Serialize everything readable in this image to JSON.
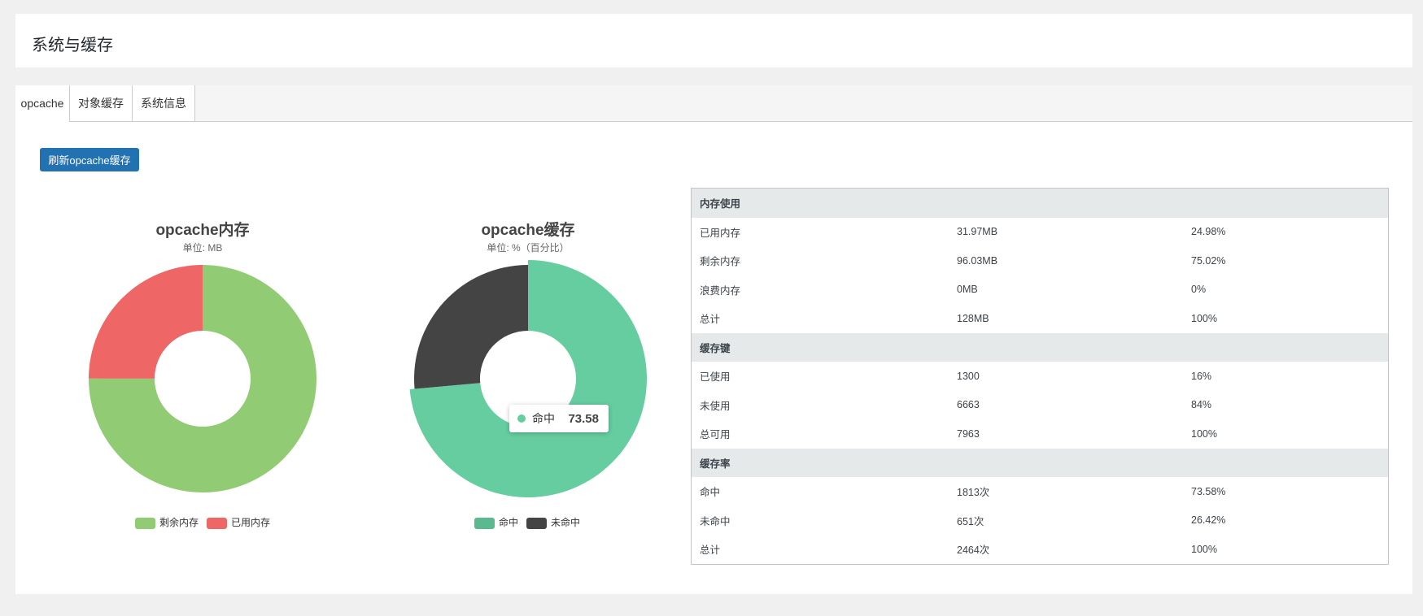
{
  "page_title": "系统与缓存",
  "tabs": [
    {
      "label": "opcache"
    },
    {
      "label": "对象缓存"
    },
    {
      "label": "系统信息"
    }
  ],
  "refresh_button": "刷新opcache缓存",
  "chart_data": [
    {
      "type": "pie",
      "title": "opcache内存",
      "subtitle": "单位: MB",
      "legend_position": "bottom",
      "slices": [
        {
          "name": "剩余内存",
          "value": 96.03,
          "color": "#91cc75"
        },
        {
          "name": "已用内存",
          "value": 31.97,
          "color": "#ee6666"
        }
      ]
    },
    {
      "type": "pie",
      "title": "opcache缓存",
      "subtitle": "单位: %（百分比）",
      "legend_position": "bottom",
      "slices": [
        {
          "name": "命中",
          "value": 73.58,
          "color": "#66cda1",
          "legend_color": "#5bb990"
        },
        {
          "name": "未命中",
          "value": 26.42,
          "color": "#444444"
        }
      ],
      "tooltip": {
        "name": "命中",
        "value": "73.58"
      }
    }
  ],
  "table": [
    {
      "section": "内存使用",
      "rows": [
        [
          "已用内存",
          "31.97MB",
          "24.98%"
        ],
        [
          "剩余内存",
          "96.03MB",
          "75.02%"
        ],
        [
          "浪费内存",
          "0MB",
          "0%"
        ],
        [
          "总计",
          "128MB",
          "100%"
        ]
      ]
    },
    {
      "section": "缓存键",
      "rows": [
        [
          "已使用",
          "1300",
          "16%"
        ],
        [
          "未使用",
          "6663",
          "84%"
        ],
        [
          "总可用",
          "7963",
          "100%"
        ]
      ]
    },
    {
      "section": "缓存率",
      "rows": [
        [
          "命中",
          "1813次",
          "73.58%"
        ],
        [
          "未命中",
          "651次",
          "26.42%"
        ],
        [
          "总计",
          "2464次",
          "100%"
        ]
      ]
    }
  ]
}
